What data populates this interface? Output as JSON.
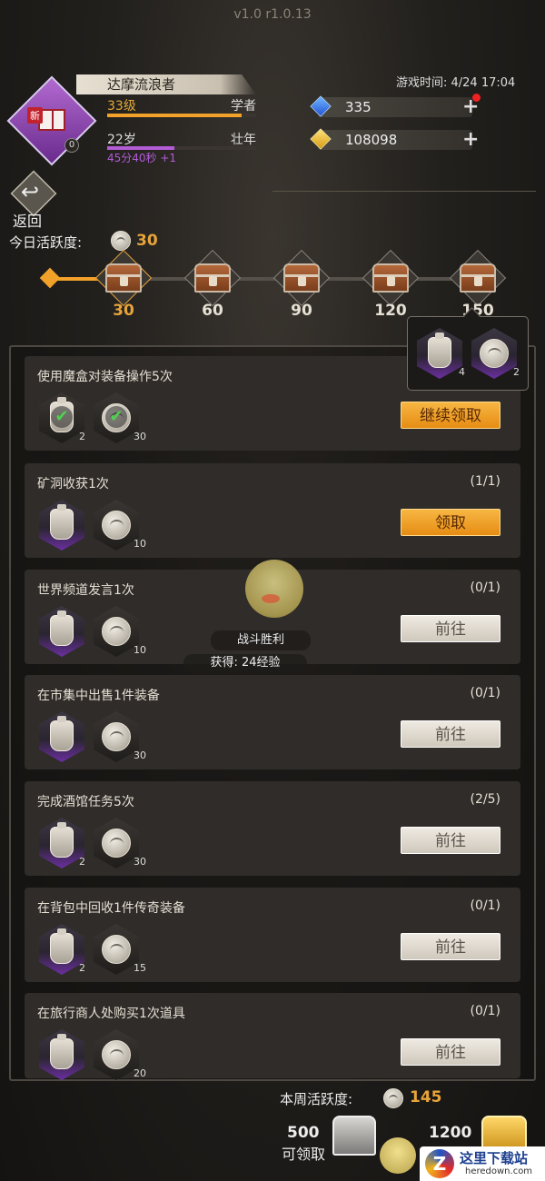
{
  "version": "v1.0 r1.0.13",
  "player": {
    "name": "达摩流浪者",
    "new_badge": "新",
    "avatar_level": "0",
    "level": "33级",
    "title": "学者",
    "level_progress": 0.9,
    "age": "22岁",
    "age_stage": "壮年",
    "age_progress": 0.45,
    "timer": "45分40秒 +1"
  },
  "game_time": "游戏时间: 4/24 17:04",
  "resources": {
    "gems": "335",
    "gold": "108098",
    "plus": "+"
  },
  "back": {
    "icon": "↩",
    "label": "返回"
  },
  "daily": {
    "label": "今日活跃度:",
    "value": "30",
    "progress": 30,
    "milestones": [
      "30",
      "60",
      "90",
      "120",
      "150"
    ]
  },
  "popup_rewards": [
    {
      "icon": "bottle-icon",
      "qty": "4"
    },
    {
      "icon": "coin-icon",
      "qty": "2"
    }
  ],
  "tasks": [
    {
      "title": "使用魔盒对装备操作5次",
      "progress": "",
      "r1_qty": "2",
      "r2_qty": "30",
      "button": "继续领取",
      "button_style": "gold"
    },
    {
      "title": "矿洞收获1次",
      "progress": "(1/1)",
      "r1_qty": "",
      "r2_qty": "10",
      "button": "领取",
      "button_style": "gold"
    },
    {
      "title": "世界频道发言1次",
      "progress": "(0/1)",
      "r1_qty": "",
      "r2_qty": "10",
      "button": "前往",
      "button_style": "grey"
    },
    {
      "title": "在市集中出售1件装备",
      "progress": "(0/1)",
      "r1_qty": "",
      "r2_qty": "30",
      "button": "前往",
      "button_style": "grey"
    },
    {
      "title": "完成酒馆任务5次",
      "progress": "(2/5)",
      "r1_qty": "2",
      "r2_qty": "30",
      "button": "前往",
      "button_style": "grey"
    },
    {
      "title": "在背包中回收1件传奇装备",
      "progress": "(0/1)",
      "r1_qty": "2",
      "r2_qty": "15",
      "button": "前往",
      "button_style": "grey"
    },
    {
      "title": "在旅行商人处购买1次道具",
      "progress": "(0/1)",
      "r1_qty": "",
      "r2_qty": "20",
      "button": "前往",
      "button_style": "grey"
    }
  ],
  "battle_toast": {
    "title": "战斗胜利",
    "exp": "获得: 24经验"
  },
  "weekly": {
    "label": "本周活跃度:",
    "value": "145",
    "milestone1": "500",
    "claim_label": "可领取",
    "milestone2": "1200"
  },
  "watermark": {
    "text": "这里下载站",
    "url": "heredown.com"
  },
  "colors": {
    "accent": "#e8a43a",
    "gold_button": "#f7b642",
    "purple": "#b25cd6"
  }
}
